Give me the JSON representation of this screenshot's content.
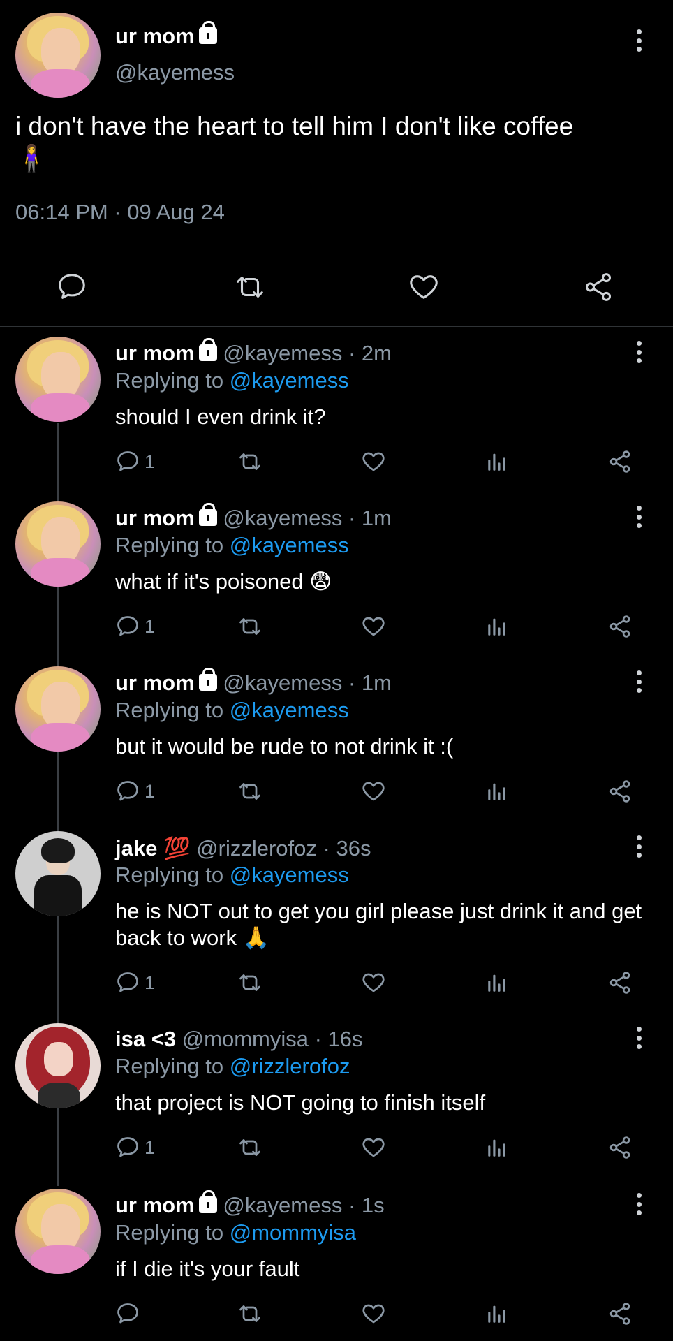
{
  "main_tweet": {
    "name": "ur mom",
    "handle": "@kayemess",
    "text": "i don't have the heart to tell him I don't like coffee",
    "emoji": "🧍‍♀️",
    "timestamp": "06:14 PM · 09 Aug 24"
  },
  "replies": [
    {
      "name": "ur mom",
      "handle": "@kayemess",
      "time": "· 2m",
      "replying_prefix": "Replying to",
      "replying_to": "@kayemess",
      "text": "should I even drink it?",
      "reply_count": "1"
    },
    {
      "name": "ur mom",
      "handle": "@kayemess",
      "time": "· 1m",
      "replying_prefix": "Replying to",
      "replying_to": "@kayemess",
      "text": "what if it's poisoned 😨",
      "reply_count": "1"
    },
    {
      "name": "ur mom",
      "handle": "@kayemess",
      "time": "· 1m",
      "replying_prefix": "Replying to",
      "replying_to": "@kayemess",
      "text": "but it would be rude to not drink it :(",
      "reply_count": "1"
    },
    {
      "name": "jake 💯",
      "handle": "@rizzlerofoz",
      "time": "· 36s",
      "replying_prefix": "Replying to",
      "replying_to": "@kayemess",
      "text": "he is NOT out to get you girl please just drink it and get back to work 🙏",
      "reply_count": "1"
    },
    {
      "name": "isa <3",
      "handle": "@mommyisa",
      "time": "· 16s",
      "replying_prefix": "Replying to",
      "replying_to": "@rizzlerofoz",
      "text": "that project is NOT going to finish itself",
      "reply_count": "1"
    },
    {
      "name": "ur mom",
      "handle": "@kayemess",
      "time": "· 1s",
      "replying_prefix": "Replying to",
      "replying_to": "@mommyisa",
      "text": "if I die it's your fault",
      "reply_count": ""
    }
  ],
  "icons": {
    "reply": "reply-icon",
    "retweet": "retweet-icon",
    "like": "heart-icon",
    "stats": "stats-icon",
    "share": "share-icon",
    "more": "more-icon",
    "lock": "lock-icon"
  },
  "colors": {
    "background": "#000000",
    "text": "#ffffff",
    "muted": "#8b98a5",
    "link": "#1d9bf0"
  }
}
